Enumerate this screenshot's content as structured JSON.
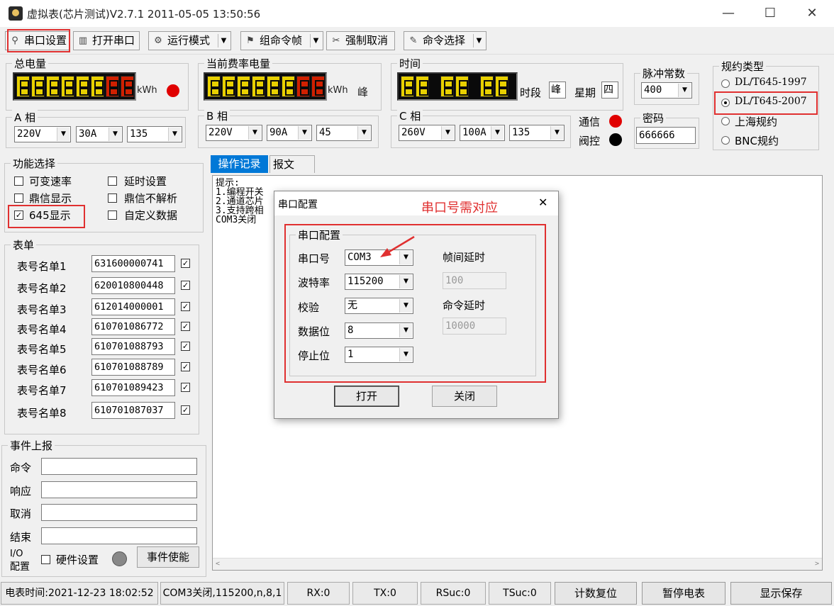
{
  "window": {
    "title": "虚拟表(芯片测试)V2.7.1 2011-05-05 13:50:56",
    "minimize": "—",
    "maximize": "☐",
    "close": "✕"
  },
  "toolbar": {
    "serial_setup": "串口设置",
    "open_serial": "打开串口",
    "run_mode": "运行模式",
    "group_frame": "组命令帧",
    "force_cancel": "强制取消",
    "cmd_select": "命令选择"
  },
  "total_energy": {
    "label": "总电量",
    "unit": "kWh",
    "indicator_color": "#e00000"
  },
  "current_rate": {
    "label": "当前费率电量",
    "unit": "kWh",
    "rate": "峰"
  },
  "time": {
    "label": "时间",
    "period_label": "时段",
    "period": "峰",
    "week_label": "星期",
    "week": "四"
  },
  "pulse": {
    "label": "脉冲常数",
    "value": "400"
  },
  "protocol": {
    "label": "规约类型",
    "options": [
      "DL/T645-1997",
      "DL/T645-2007",
      "上海规约",
      "BNC规约"
    ],
    "selected": "DL/T645-2007"
  },
  "phaseA": {
    "label": "A 相",
    "voltage": "220V",
    "current": "30A",
    "angle": "135"
  },
  "phaseB": {
    "label": "B 相",
    "voltage": "220V",
    "current": "90A",
    "angle": "45"
  },
  "phaseC": {
    "label": "C 相",
    "voltage": "260V",
    "current": "100A",
    "angle": "135"
  },
  "comm": {
    "comm_label": "通信",
    "relay_label": "阀控",
    "comm_color": "#e00000",
    "relay_color": "#000000"
  },
  "password": {
    "label": "密码",
    "value": "666666"
  },
  "functions": {
    "label": "功能选择",
    "items": [
      {
        "text": "可变速率",
        "checked": false
      },
      {
        "text": "延时设置",
        "checked": false
      },
      {
        "text": "鼎信显示",
        "checked": false
      },
      {
        "text": "鼎信不解析",
        "checked": false
      },
      {
        "text": "645显示",
        "checked": true
      },
      {
        "text": "自定义数据",
        "checked": false
      }
    ]
  },
  "meters": {
    "label": "表单",
    "rows": [
      {
        "name": "表号名单1",
        "value": "631600000741"
      },
      {
        "name": "表号名单2",
        "value": "620010800448"
      },
      {
        "name": "表号名单3",
        "value": "612014000001"
      },
      {
        "name": "表号名单4",
        "value": "610701086772"
      },
      {
        "name": "表号名单5",
        "value": "610701088793"
      },
      {
        "name": "表号名单6",
        "value": "610701088789"
      },
      {
        "name": "表号名单7",
        "value": "610701089423"
      },
      {
        "name": "表号名单8",
        "value": "610701087037"
      }
    ]
  },
  "events": {
    "label": "事件上报",
    "cmd": "命令",
    "resp": "响应",
    "cancel": "取消",
    "end": "结束",
    "io_line1": "I/O",
    "io_line2": "配置",
    "hw_setting": "硬件设置",
    "enable_btn": "事件使能"
  },
  "tabs": {
    "log": "操作记录",
    "message": "报文"
  },
  "log": {
    "lines": [
      "提示:",
      "1.编程开关",
      "2.通道芯片",
      "3.支持跨相",
      "COM3关闭"
    ]
  },
  "dialog": {
    "title": "串口配置",
    "close": "✕",
    "annotation": "串口号需对应",
    "group": "串口配置",
    "port_label": "串口号",
    "port": "COM3",
    "baud_label": "波特率",
    "baud": "115200",
    "parity_label": "校验",
    "parity": "无",
    "databits_label": "数据位",
    "databits": "8",
    "stopbits_label": "停止位",
    "stopbits": "1",
    "frame_delay_label": "帧间延时",
    "frame_delay": "100",
    "cmd_delay_label": "命令延时",
    "cmd_delay": "10000",
    "open_btn": "打开",
    "close_btn": "关闭"
  },
  "status": {
    "meter_time": "电表时间:2021-12-23 18:02:52",
    "port_info": "COM3关闭,115200,n,8,1",
    "rx": "RX:0",
    "tx": "TX:0",
    "rsuc": "RSuc:0",
    "tsuc": "TSuc:0",
    "reset_btn": "计数复位",
    "pause_btn": "暂停电表",
    "save_btn": "显示保存"
  }
}
